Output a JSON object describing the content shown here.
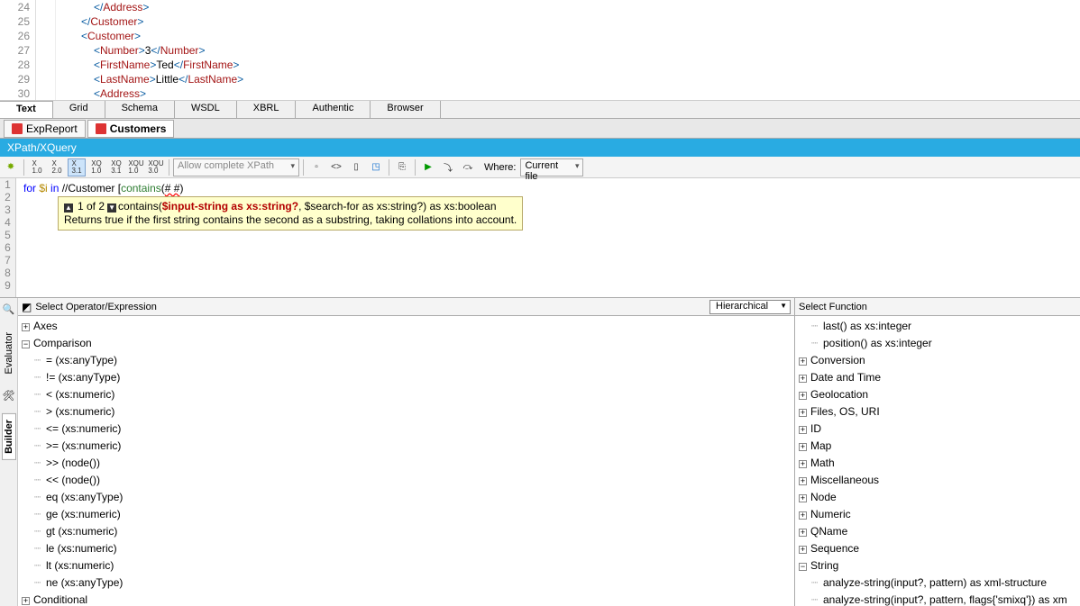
{
  "code": {
    "lines": [
      "24",
      "25",
      "26",
      "27",
      "28",
      "29",
      "30"
    ],
    "l24": "</Address>",
    "l25": "</Customer>",
    "l26": "<Customer>",
    "l27_open": "<Number>",
    "l27_txt": "3",
    "l27_close": "</Number>",
    "l28_open": "<FirstName>",
    "l28_txt": "Ted",
    "l28_close": "</FirstName>",
    "l29_open": "<LastName>",
    "l29_txt": "Little",
    "l29_close": "</LastName>",
    "l30": "<Address>"
  },
  "viewTabs": [
    "Text",
    "Grid",
    "Schema",
    "WSDL",
    "XBRL",
    "Authentic",
    "Browser"
  ],
  "docTabs": [
    "ExpReport",
    "Customers"
  ],
  "panelTitle": "XPath/XQuery",
  "toolbar": {
    "modes": [
      "XPath 1.0",
      "XPath 2.0",
      "XPath 3.1",
      "XQ 1.0",
      "XQ 3.1",
      "XQU 1.0",
      "XQU 3.0"
    ],
    "allow": "Allow complete XPath",
    "whereLabel": "Where:",
    "whereValue": "Current file"
  },
  "expr": {
    "text_for": "for ",
    "text_var": "$i",
    "text_in": " in ",
    "text_path": "//Customer ",
    "text_br": "[",
    "text_fn": "contains",
    "text_paren": "(",
    "text_arg": "#   #",
    "text_close": ")"
  },
  "tooltip": {
    "count": "1 of 2",
    "sig_name": "contains(",
    "arg1": "$input-string as xs:string?",
    "sig_rest": ", $search-for as xs:string?) as xs:boolean",
    "desc": "Returns true if the first string contains the second as a substring, taking collations into account."
  },
  "opHeader": "Select Operator/Expression",
  "hier": "Hierarchical",
  "ops": {
    "axes": "Axes",
    "comparison": "Comparison",
    "items": [
      "= (xs:anyType)",
      "!= (xs:anyType)",
      "< (xs:numeric)",
      "> (xs:numeric)",
      "<= (xs:numeric)",
      ">= (xs:numeric)",
      ">> (node())",
      "<< (node())",
      "eq (xs:anyType)",
      "ge (xs:numeric)",
      "gt (xs:numeric)",
      "le (xs:numeric)",
      "lt (xs:numeric)",
      "ne (xs:anyType)"
    ],
    "conditional": "Conditional"
  },
  "fnHeader": "Select Function",
  "fns": {
    "top": [
      "last() as xs:integer",
      "position() as xs:integer"
    ],
    "cats": [
      "Conversion",
      "Date and Time",
      "Geolocation",
      "Files, OS, URI",
      "ID",
      "Map",
      "Math",
      "Miscellaneous",
      "Node",
      "Numeric",
      "QName",
      "Sequence"
    ],
    "string": "String",
    "stringItems": [
      "analyze-string(input?, pattern) as xml-structure",
      "analyze-string(input?, pattern, flags{'smixq'}) as xm"
    ]
  },
  "sideTabs": {
    "builder": "Builder",
    "evaluator": "Evaluator"
  },
  "ruler": [
    "1",
    "2",
    "3",
    "4",
    "5",
    "6",
    "7",
    "8",
    "9"
  ]
}
